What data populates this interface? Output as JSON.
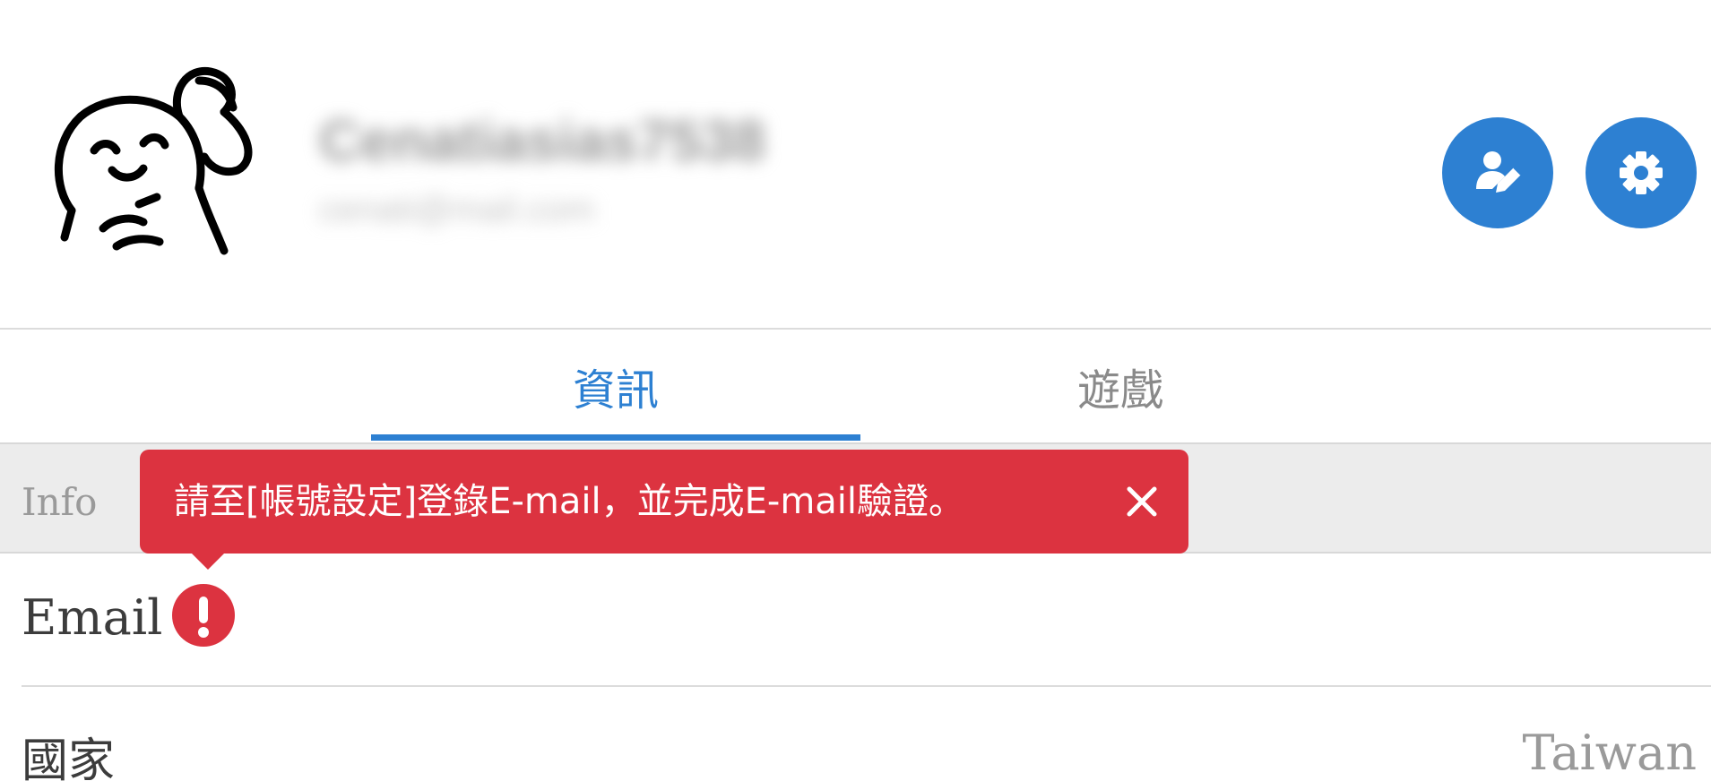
{
  "profile": {
    "name": "Cenatiasias7538",
    "email": "cenati@mail.com"
  },
  "actions": {
    "edit_profile_icon": "edit-profile-icon",
    "settings_icon": "gear-icon"
  },
  "tabs": [
    {
      "label": "資訊",
      "active": true
    },
    {
      "label": "遊戲",
      "active": false
    }
  ],
  "section": {
    "title": "Info"
  },
  "tooltip": {
    "message": "請至[帳號設定]登錄E-mail，並完成E-mail驗證。",
    "close_icon": "close-icon"
  },
  "rows": {
    "email_label": "Email",
    "country_label": "國家",
    "country_value": "Taiwan"
  },
  "colors": {
    "accent": "#2d80d2",
    "alert": "#dc3340",
    "section_bg": "#ececec",
    "muted_text": "#9a9a9a"
  }
}
